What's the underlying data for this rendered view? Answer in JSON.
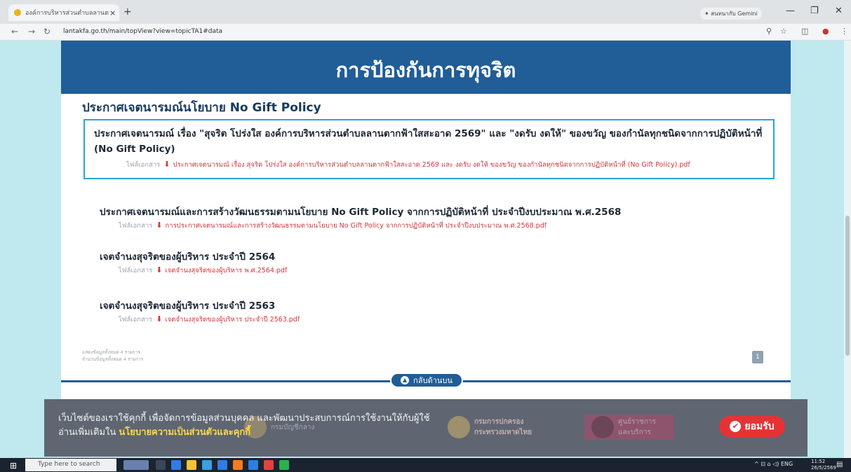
{
  "browser": {
    "tab_title": "องค์การบริหารส่วนตำบลลานตากฟ้า",
    "tab_close": "×",
    "new_tab": "+",
    "gemini_label": "✦ สนทนากับ Gemini",
    "url": "lantakfa.go.th/main/topView?view=topicTA1#data"
  },
  "page": {
    "title": "การป้องกันการทุจริต",
    "section_title": "ประกาศเจตนารมณ์นโยบาย No Gift Policy",
    "file_label": "ไฟล์เอกสาร",
    "items": [
      {
        "title": "ประกาศเจตนารมณ์ เรื่อง \"สุจริต โปร่งใส องค์การบริหารส่วนตำบลลานตากฟ้าใสสะอาด 2569\" และ \"งดรับ งดให้\" ของขวัญ ของกำนัลทุกชนิดจากการปฏิบัติหน้าที่ (No Gift Policy)",
        "file": "ประกาศเจตนารมณ์ เรื่อง สุจริต โปร่งใส องค์การบริหารส่วนตำบลลานตากฟ้าใสสะอาด 2569 และ งดรับ งดให้ ของขวัญ ของกำนัลทุกชนิดจากการปฏิบัติหน้าที่ (No Gift Policy).pdf"
      },
      {
        "title": "ประกาศเจตนารมณ์และการสร้างวัฒนธรรมตามนโยบาย No Gift Policy จากการปฏิบัติหน้าที่ ประจำปีงบประมาณ พ.ศ.2568",
        "file": "การประกาศเจตนารมณ์และการสร้างวัฒนธรรมตามนโยบาย No Gift Policy จากการปฏิบัติหน้าที่ ประจำปีงบประมาณ พ.ศ.2568.pdf"
      },
      {
        "title": "เจตจำนงสุจริตของผู้บริหาร ประจำปี 2564",
        "file": "เจตจำนงสุจริตของผู้บริหาร พ.ศ.2564.pdf"
      },
      {
        "title": "เจตจำนงสุจริตของผู้บริหาร ประจำปี 2563",
        "file": "เจตจำนงสุจริตของผู้บริหาร ประจำปี 2563.pdf"
      }
    ],
    "stats_line1": "แสดงข้อมูลทั้งหมด 4 รายการ",
    "stats_line2": "จำนวนข้อมูลทั้งหมด 4 รายการ",
    "page_number": "1",
    "back_to_top": "กลับด้านบน"
  },
  "cookie": {
    "line1": "เว็บไซต์ของเราใช้คุกกี้ เพื่อจัดการข้อมูลส่วนบุคคล และพัฒนาประสบการณ์การใช้งานให้กับผู้ใช้",
    "line2_prefix": "อ่านเพิ่มเติมใน ",
    "policy_link": "นโยบายความเป็นส่วนตัวและคุกกี้",
    "accept": "ยอมรับ",
    "logo1": "กรมบัญชีกลาง",
    "logo2": "กรมการปกครอง กระทรวงมหาดไทย",
    "logo3": "ศูนย์ราชการ และบริการ"
  },
  "taskbar": {
    "search_placeholder": "Type here to search",
    "lang": "ENG",
    "time": "11:52",
    "date": "26/5/2569"
  },
  "colors": {
    "header_blue": "#215d97",
    "highlight_border": "#2aa2dd",
    "file_red": "#d3363d",
    "accept_red": "#e53335",
    "link_yellow": "#ffd84a"
  }
}
